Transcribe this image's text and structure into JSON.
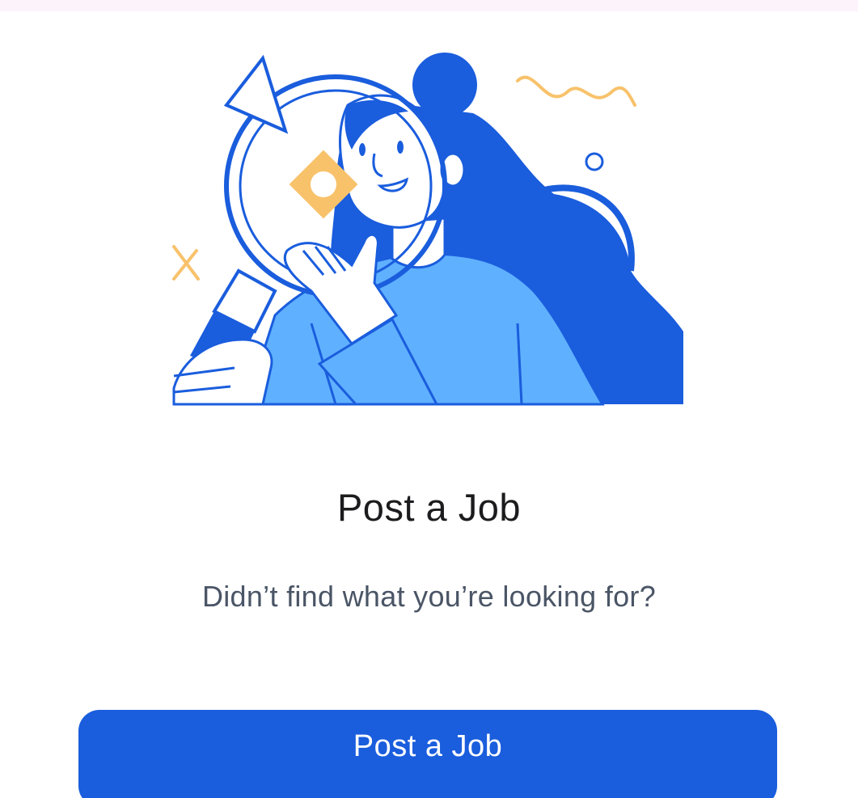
{
  "empty_state": {
    "illustration": "woman-with-magnifying-glass-illustration",
    "title": "Post a Job",
    "subtitle": "Didn’t find what you’re looking for?"
  },
  "actions": {
    "post_job_label": "Post a Job"
  },
  "colors": {
    "primary": "#1a5ddd",
    "light_blue": "#5fb0ff",
    "accent_yellow": "#f8c26b",
    "title_text": "#1c1c1e",
    "subtitle_text": "#4a5566",
    "top_strip": "#fdf3fb"
  }
}
